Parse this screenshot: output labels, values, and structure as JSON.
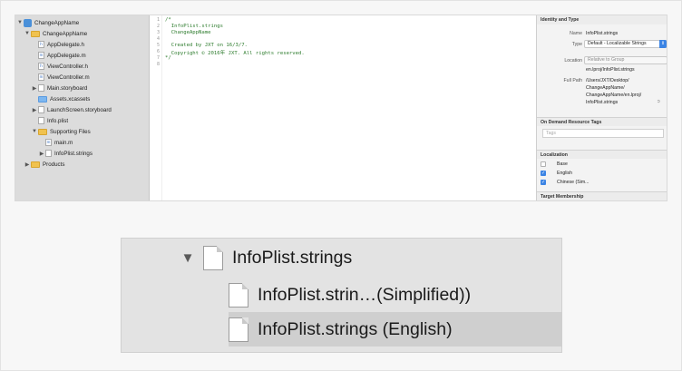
{
  "navigator": {
    "items": [
      {
        "label": "ChangeAppName",
        "icon": "project-icon",
        "disclosure": "▼"
      },
      {
        "label": "ChangeAppName",
        "icon": "folder-icon",
        "disclosure": "▼"
      },
      {
        "label": "AppDelegate.h",
        "icon": "header-file-icon",
        "badge": "h"
      },
      {
        "label": "AppDelegate.m",
        "icon": "source-file-icon",
        "badge": "m"
      },
      {
        "label": "ViewController.h",
        "icon": "header-file-icon",
        "badge": "h"
      },
      {
        "label": "ViewController.m",
        "icon": "source-file-icon",
        "badge": "m"
      },
      {
        "label": "Main.storyboard",
        "icon": "storyboard-icon",
        "disclosure": "▶"
      },
      {
        "label": "Assets.xcassets",
        "icon": "assets-icon"
      },
      {
        "label": "LaunchScreen.storyboard",
        "icon": "storyboard-icon",
        "disclosure": "▶"
      },
      {
        "label": "Info.plist",
        "icon": "plist-icon"
      },
      {
        "label": "Supporting Files",
        "icon": "folder-icon",
        "disclosure": "▼"
      },
      {
        "label": "main.m",
        "icon": "source-file-icon",
        "badge": "m"
      },
      {
        "label": "InfoPlist.strings",
        "icon": "strings-file-icon",
        "disclosure": "▶"
      },
      {
        "label": "Products",
        "icon": "folder-icon",
        "disclosure": "▶"
      }
    ]
  },
  "editor": {
    "line_numbers": [
      "1",
      "2",
      "3",
      "4",
      "5",
      "6",
      "7",
      "8"
    ],
    "lines": [
      "/*",
      "  InfoPlist.strings",
      "  ChangeAppName",
      "",
      "  Created by JXT on 16/3/7.",
      "  Copyright © 2016年 JXT. All rights reserved.",
      "*/",
      ""
    ]
  },
  "inspector": {
    "identity_header": "Identity and Type",
    "name_label": "Name",
    "name_value": "InfoPlist.strings",
    "type_label": "Type",
    "type_value": "Default - Localizable Strings",
    "location_label": "Location",
    "location_value": "Relative to Group",
    "location_path": "en.lproj/InfoPlist.strings",
    "fullpath_label": "Full Path",
    "fullpath_lines": [
      "/Users/JXT/Desktop/",
      "ChangeAppName/",
      "ChangeAppName/en.lproj/",
      "InfoPlist.strings"
    ],
    "odr_header": "On Demand Resource Tags",
    "tags_placeholder": "Tags",
    "localization_header": "Localization",
    "localizations": [
      {
        "label": "Base",
        "checked": false
      },
      {
        "label": "English",
        "checked": true
      },
      {
        "label": "Chinese (Sim...",
        "checked": true
      }
    ],
    "target_header": "Target Membership"
  },
  "zoomed": {
    "disclosure": "▼",
    "parent": "InfoPlist.strings",
    "children": [
      "InfoPlist.strin…(Simplified))",
      "InfoPlist.strings (English)"
    ]
  },
  "colors": {
    "accent": "#3b84e4",
    "code": "#2f7d2f",
    "selection": "#cfcfcf"
  }
}
